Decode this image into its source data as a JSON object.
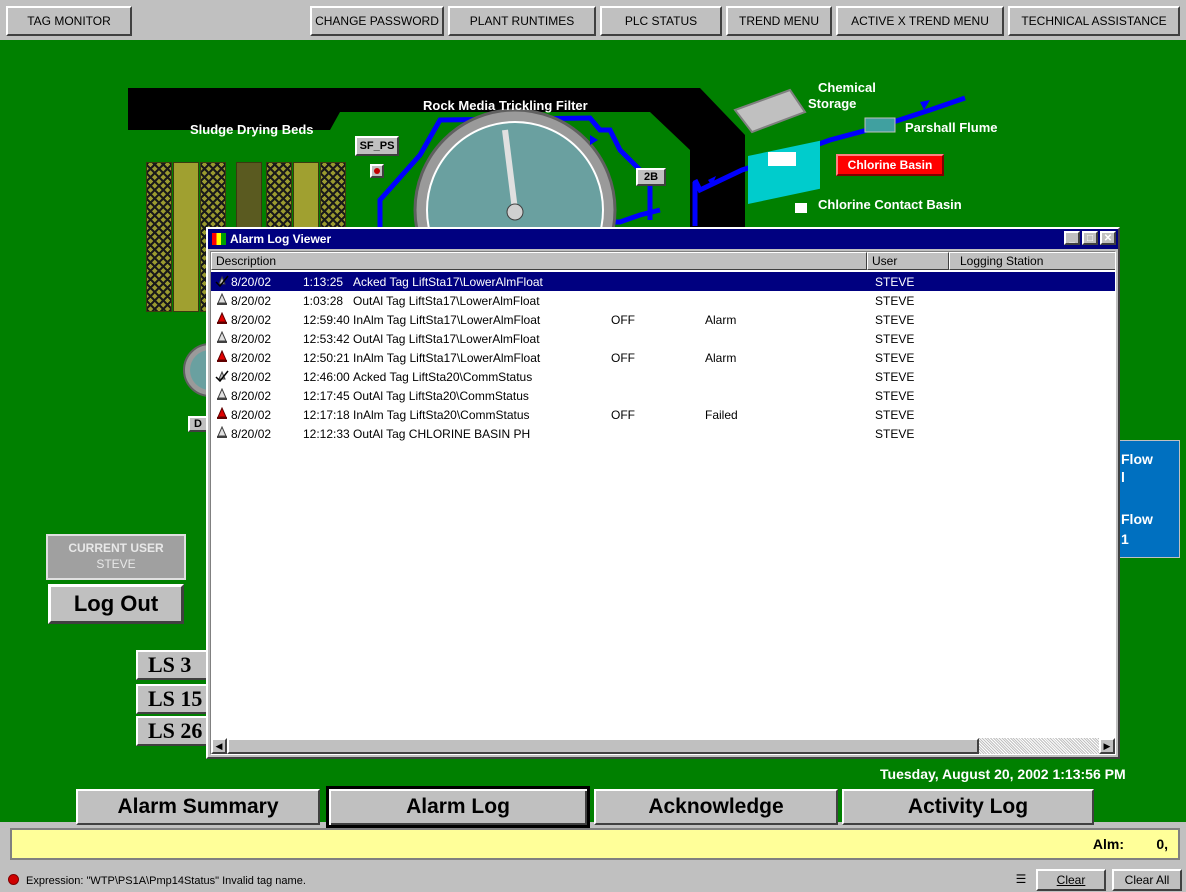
{
  "top_buttons": {
    "tag_monitor": "TAG MONITOR",
    "change_password": "CHANGE PASSWORD",
    "plant_runtimes": "PLANT RUNTIMES",
    "plc_status": "PLC STATUS",
    "trend_menu": "TREND MENU",
    "activex_trend_menu": "ACTIVE X TREND MENU",
    "technical_assistance": "TECHNICAL ASSISTANCE"
  },
  "plant": {
    "sludge_drying_beds": "Sludge Drying Beds",
    "rock_media_filter": "Rock Media Trickling Filter",
    "chemical_storage_line1": "Chemical",
    "chemical_storage_line2": "Storage",
    "parshall_flume": "Parshall Flume",
    "chlorine_basin": "Chlorine Basin",
    "chlorine_contact_basin": "Chlorine Contact Basin",
    "sf_ps": "SF_PS",
    "tag_2b": "2B",
    "partial_d": "D",
    "flow_label_1": "Flow",
    "flow_value_1": "l",
    "flow_label_2": "Flow",
    "flow_value_2": "1",
    "colors": {
      "background": "#008000",
      "pipe": "#0000ff",
      "water": "#00cccc",
      "alarm_red": "#ff0000"
    }
  },
  "user_panel": {
    "current_user_label": "CURRENT USER",
    "current_user": "STEVE",
    "logout": "Log Out"
  },
  "lift_stations": [
    "LS 3",
    "LS 15",
    "LS 26"
  ],
  "alarm_window": {
    "title": "Alarm Log Viewer",
    "columns": {
      "description": "Description",
      "user": "User",
      "logging_station": "Logging Station"
    },
    "rows": [
      {
        "icon": "ack-check-icon",
        "date": "8/20/02",
        "time": "1:13:25",
        "text": "Acked Tag LiftSta17\\LowerAlmFloat",
        "value": "",
        "state": "",
        "user": "STEVE",
        "selected": true
      },
      {
        "icon": "bell-gray-icon",
        "date": "8/20/02",
        "time": "1:03:28",
        "text": "OutAl Tag LiftSta17\\LowerAlmFloat",
        "value": "",
        "state": "",
        "user": "STEVE"
      },
      {
        "icon": "bell-red-icon",
        "date": "8/20/02",
        "time": "12:59:40",
        "text": "InAlm Tag LiftSta17\\LowerAlmFloat",
        "value": "OFF",
        "state": "Alarm",
        "user": "STEVE"
      },
      {
        "icon": "bell-gray-icon",
        "date": "8/20/02",
        "time": "12:53:42",
        "text": "OutAl Tag LiftSta17\\LowerAlmFloat",
        "value": "",
        "state": "",
        "user": "STEVE"
      },
      {
        "icon": "bell-red-icon",
        "date": "8/20/02",
        "time": "12:50:21",
        "text": "InAlm Tag LiftSta17\\LowerAlmFloat",
        "value": "OFF",
        "state": "Alarm",
        "user": "STEVE"
      },
      {
        "icon": "ack-check-icon",
        "date": "8/20/02",
        "time": "12:46:00",
        "text": "Acked Tag LiftSta20\\CommStatus",
        "value": "",
        "state": "",
        "user": "STEVE"
      },
      {
        "icon": "bell-gray-icon",
        "date": "8/20/02",
        "time": "12:17:45",
        "text": "OutAl Tag LiftSta20\\CommStatus",
        "value": "",
        "state": "",
        "user": "STEVE"
      },
      {
        "icon": "bell-red-icon",
        "date": "8/20/02",
        "time": "12:17:18",
        "text": "InAlm Tag LiftSta20\\CommStatus",
        "value": "OFF",
        "state": "Failed",
        "user": "STEVE"
      },
      {
        "icon": "bell-gray-icon",
        "date": "8/20/02",
        "time": "12:12:33",
        "text": "OutAl Tag CHLORINE BASIN PH",
        "value": "",
        "state": "",
        "user": "STEVE"
      }
    ]
  },
  "datetime": "Tuesday, August 20, 2002  1:13:56 PM",
  "bottom_buttons": {
    "alarm_summary": "Alarm Summary",
    "alarm_log": "Alarm Log",
    "acknowledge": "Acknowledge",
    "activity_log": "Activity Log"
  },
  "alarm_count": {
    "label": "Alm:",
    "value": "0,"
  },
  "status_bar": {
    "message": "Expression: \"WTP\\PS1A\\Pmp14Status\"  Invalid tag name.",
    "clear": "Clear",
    "clear_all": "Clear All"
  }
}
